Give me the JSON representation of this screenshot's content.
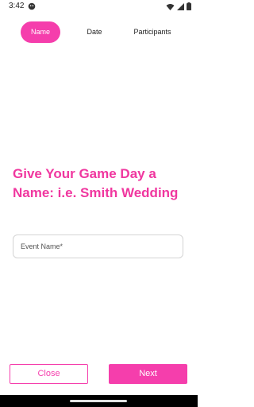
{
  "status_bar": {
    "time": "3:42",
    "icons": [
      "notification-icon",
      "wifi-icon",
      "signal-icon",
      "battery-icon"
    ]
  },
  "stepper": {
    "steps": [
      {
        "label": "Name",
        "active": true
      },
      {
        "label": "Date",
        "active": false
      },
      {
        "label": "Participants",
        "active": false
      }
    ]
  },
  "main": {
    "heading": "Give Your Game Day a Name: i.e. Smith Wedding",
    "event_name_field": {
      "placeholder": "Event Name*",
      "value": ""
    }
  },
  "actions": {
    "close_label": "Close",
    "next_label": "Next"
  },
  "colors": {
    "accent": "#f53eac",
    "heading": "#f0379f"
  }
}
